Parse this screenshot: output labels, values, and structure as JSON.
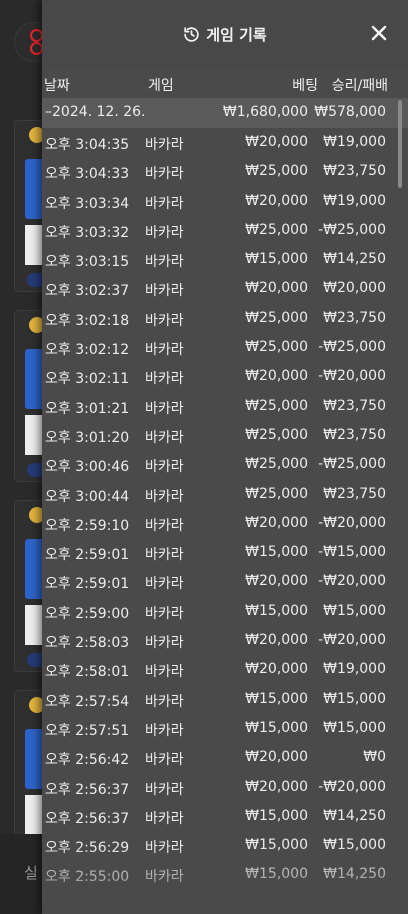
{
  "modal": {
    "title": "게임 기록",
    "icon": "history-icon",
    "close_icon": "close-icon"
  },
  "columns": {
    "date": "날짜",
    "game": "게임",
    "bet": "베팅",
    "win_loss": "승리/패배"
  },
  "summary": {
    "date": "–2024. 12. 26.",
    "bet": "₩1,680,000",
    "win_loss": "₩578,000"
  },
  "rows": [
    {
      "time": "오후 3:04:35",
      "game": "바카라",
      "bet": "₩20,000",
      "result": "₩19,000"
    },
    {
      "time": "오후 3:04:33",
      "game": "바카라",
      "bet": "₩25,000",
      "result": "₩23,750"
    },
    {
      "time": "오후 3:03:34",
      "game": "바카라",
      "bet": "₩20,000",
      "result": "₩19,000"
    },
    {
      "time": "오후 3:03:32",
      "game": "바카라",
      "bet": "₩25,000",
      "result": "-₩25,000"
    },
    {
      "time": "오후 3:03:15",
      "game": "바카라",
      "bet": "₩15,000",
      "result": "₩14,250"
    },
    {
      "time": "오후 3:02:37",
      "game": "바카라",
      "bet": "₩20,000",
      "result": "₩20,000"
    },
    {
      "time": "오후 3:02:18",
      "game": "바카라",
      "bet": "₩25,000",
      "result": "₩23,750"
    },
    {
      "time": "오후 3:02:12",
      "game": "바카라",
      "bet": "₩25,000",
      "result": "-₩25,000"
    },
    {
      "time": "오후 3:02:11",
      "game": "바카라",
      "bet": "₩20,000",
      "result": "-₩20,000"
    },
    {
      "time": "오후 3:01:21",
      "game": "바카라",
      "bet": "₩25,000",
      "result": "₩23,750"
    },
    {
      "time": "오후 3:01:20",
      "game": "바카라",
      "bet": "₩25,000",
      "result": "₩23,750"
    },
    {
      "time": "오후 3:00:46",
      "game": "바카라",
      "bet": "₩25,000",
      "result": "-₩25,000"
    },
    {
      "time": "오후 3:00:44",
      "game": "바카라",
      "bet": "₩25,000",
      "result": "₩23,750"
    },
    {
      "time": "오후 2:59:10",
      "game": "바카라",
      "bet": "₩20,000",
      "result": "-₩20,000"
    },
    {
      "time": "오후 2:59:01",
      "game": "바카라",
      "bet": "₩15,000",
      "result": "-₩15,000"
    },
    {
      "time": "오후 2:59:01",
      "game": "바카라",
      "bet": "₩20,000",
      "result": "-₩20,000"
    },
    {
      "time": "오후 2:59:00",
      "game": "바카라",
      "bet": "₩15,000",
      "result": "₩15,000"
    },
    {
      "time": "오후 2:58:03",
      "game": "바카라",
      "bet": "₩20,000",
      "result": "-₩20,000"
    },
    {
      "time": "오후 2:58:01",
      "game": "바카라",
      "bet": "₩20,000",
      "result": "₩19,000"
    },
    {
      "time": "오후 2:57:54",
      "game": "바카라",
      "bet": "₩15,000",
      "result": "₩15,000"
    },
    {
      "time": "오후 2:57:51",
      "game": "바카라",
      "bet": "₩15,000",
      "result": "₩15,000"
    },
    {
      "time": "오후 2:56:42",
      "game": "바카라",
      "bet": "₩20,000",
      "result": "₩0"
    },
    {
      "time": "오후 2:56:37",
      "game": "바카라",
      "bet": "₩20,000",
      "result": "-₩20,000"
    },
    {
      "time": "오후 2:56:37",
      "game": "바카라",
      "bet": "₩15,000",
      "result": "₩14,250"
    },
    {
      "time": "오후 2:56:29",
      "game": "바카라",
      "bet": "₩15,000",
      "result": "₩15,000"
    },
    {
      "time": "오후 2:55:00",
      "game": "바카라",
      "bet": "₩15,000",
      "result": "₩14,250"
    }
  ],
  "background": {
    "bottom_text": "실"
  }
}
